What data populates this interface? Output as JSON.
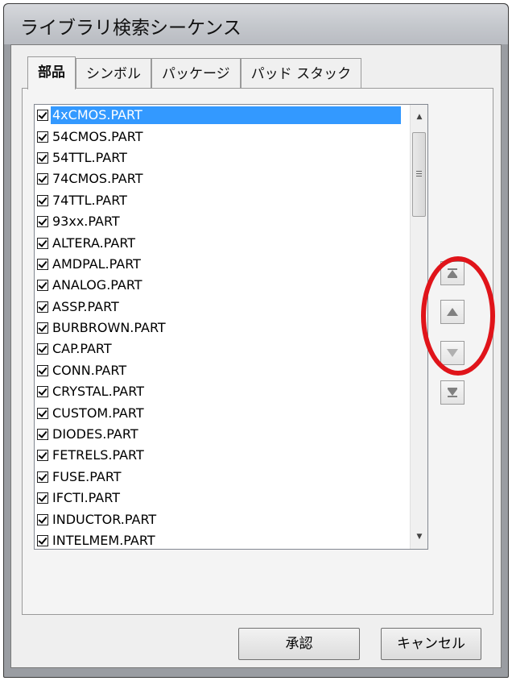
{
  "window": {
    "title": "ライブラリ検索シーケンス"
  },
  "tabs": [
    {
      "label": "部品",
      "active": true
    },
    {
      "label": "シンボル",
      "active": false
    },
    {
      "label": "パッケージ",
      "active": false
    },
    {
      "label": "パッド スタック",
      "active": false
    }
  ],
  "library_list": {
    "selected_index": 0,
    "items": [
      {
        "name": "4xCMOS.PART",
        "checked": true
      },
      {
        "name": "54CMOS.PART",
        "checked": true
      },
      {
        "name": "54TTL.PART",
        "checked": true
      },
      {
        "name": "74CMOS.PART",
        "checked": true
      },
      {
        "name": "74TTL.PART",
        "checked": true
      },
      {
        "name": "93xx.PART",
        "checked": true
      },
      {
        "name": "ALTERA.PART",
        "checked": true
      },
      {
        "name": "AMDPAL.PART",
        "checked": true
      },
      {
        "name": "ANALOG.PART",
        "checked": true
      },
      {
        "name": "ASSP.PART",
        "checked": true
      },
      {
        "name": "BURBROWN.PART",
        "checked": true
      },
      {
        "name": "CAP.PART",
        "checked": true
      },
      {
        "name": "CONN.PART",
        "checked": true
      },
      {
        "name": "CRYSTAL.PART",
        "checked": true
      },
      {
        "name": "CUSTOM.PART",
        "checked": true
      },
      {
        "name": "DIODES.PART",
        "checked": true
      },
      {
        "name": "FETRELS.PART",
        "checked": true
      },
      {
        "name": "FUSE.PART",
        "checked": true
      },
      {
        "name": "IFCTI.PART",
        "checked": true
      },
      {
        "name": "INDUCTOR.PART",
        "checked": true
      },
      {
        "name": "INTELMEM.PART",
        "checked": true
      }
    ]
  },
  "move_buttons": [
    {
      "icon": "move-top-icon",
      "enabled": true
    },
    {
      "icon": "move-up-icon",
      "enabled": true
    },
    {
      "icon": "move-down-icon",
      "enabled": false
    },
    {
      "icon": "move-bottom-icon",
      "enabled": true
    }
  ],
  "buttons": {
    "ok": "承認",
    "cancel": "キャンセル"
  },
  "colors": {
    "selection": "#3399ff",
    "annotation": "#e0141a"
  }
}
